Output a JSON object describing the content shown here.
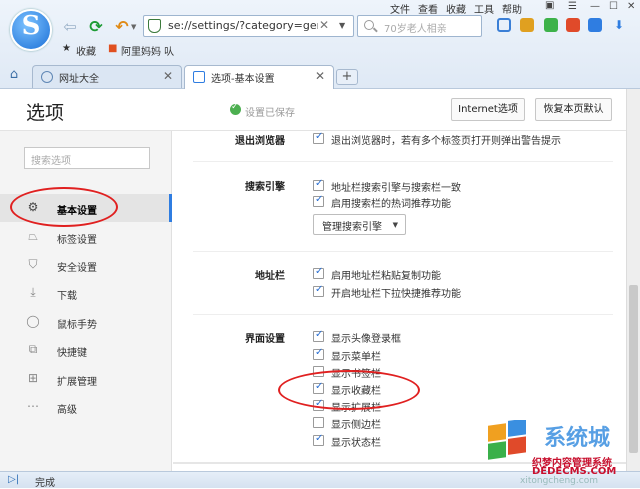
{
  "window": {
    "menus": [
      "文件",
      "查看",
      "收藏",
      "工具",
      "帮助"
    ]
  },
  "toolbar": {
    "url": "se://settings/?category=gen",
    "search_placeholder": "70岁老人相亲"
  },
  "favorites_bar": {
    "items": [
      "收藏",
      "阿里妈妈 㕥"
    ]
  },
  "tabs": [
    {
      "label": "网址大全",
      "active": false
    },
    {
      "label": "选项-基本设置",
      "active": true
    }
  ],
  "header": {
    "title": "选项",
    "saved_status": "设置已保存",
    "internet_options_label": "Internet选项",
    "restore_defaults_label": "恢复本页默认"
  },
  "sidebar": {
    "search_placeholder": "搜索选项",
    "items": [
      {
        "label": "基本设置",
        "icon": "gear-icon",
        "active": true
      },
      {
        "label": "标签设置",
        "icon": "tab-icon",
        "active": false
      },
      {
        "label": "安全设置",
        "icon": "shield-icon",
        "active": false
      },
      {
        "label": "下载",
        "icon": "download-icon",
        "active": false
      },
      {
        "label": "鼠标手势",
        "icon": "mouse-icon",
        "active": false
      },
      {
        "label": "快捷键",
        "icon": "shortcut-icon",
        "active": false
      },
      {
        "label": "扩展管理",
        "icon": "extension-icon",
        "active": false
      },
      {
        "label": "高级",
        "icon": "more-icon",
        "active": false
      }
    ]
  },
  "content": {
    "exit_browser": {
      "label": "退出浏览器",
      "options": [
        {
          "text": "退出浏览器时，若有多个标签页打开则弹出警告提示",
          "checked": true
        }
      ]
    },
    "search_engine": {
      "label": "搜索引擎",
      "options": [
        {
          "text": "地址栏搜索引擎与搜索栏一致",
          "checked": true
        },
        {
          "text": "启用搜索栏的热词推荐功能",
          "checked": true
        }
      ],
      "manage_button": "管理搜索引擎"
    },
    "address_bar": {
      "label": "地址栏",
      "options": [
        {
          "text": "启用地址栏粘贴复制功能",
          "checked": true
        },
        {
          "text": "开启地址栏下拉快捷推荐功能",
          "checked": true
        }
      ]
    },
    "interface": {
      "label": "界面设置",
      "options": [
        {
          "text": "显示头像登录框",
          "checked": true
        },
        {
          "text": "显示菜单栏",
          "checked": true
        },
        {
          "text": "显示书签栏",
          "checked": false
        },
        {
          "text": "显示收藏栏",
          "checked": true
        },
        {
          "text": "显示扩展栏",
          "checked": true
        },
        {
          "text": "显示侧边栏",
          "checked": false
        },
        {
          "text": "显示状态栏",
          "checked": true
        }
      ]
    }
  },
  "statusbar": {
    "text": "完成"
  },
  "watermark": {
    "title": "系统城",
    "line1": "织梦内容管理系统",
    "line2": "DEDECMS.COM",
    "line3": "xitongcheng.com"
  },
  "colors": {
    "accent": "#2f7de1",
    "annotation": "#e02020"
  }
}
